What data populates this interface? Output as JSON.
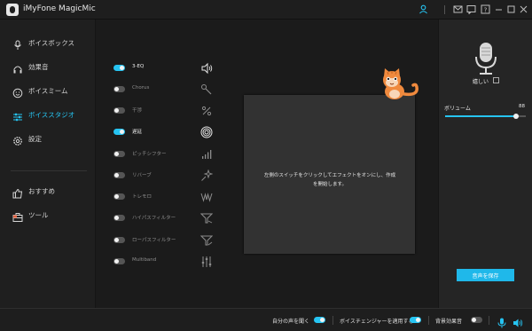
{
  "window": {
    "title": "iMyFone MagicMic",
    "icons": [
      "user-icon",
      "mail-icon",
      "feedback-icon",
      "help-icon",
      "minimize-icon",
      "maximize-icon",
      "close-icon"
    ]
  },
  "sidebar": {
    "items": [
      {
        "label": "ボイスボックス",
        "icon": "microphone-icon"
      },
      {
        "label": "効果音",
        "icon": "headphones-icon"
      },
      {
        "label": "ボイスミーム",
        "icon": "smiley-icon"
      },
      {
        "label": "ボイススタジオ",
        "icon": "sliders-icon",
        "active": true
      },
      {
        "label": "設定",
        "icon": "gear-icon"
      }
    ],
    "bottom_items": [
      {
        "label": "おすすめ",
        "icon": "thumbs-up-icon"
      },
      {
        "label": "ツール",
        "icon": "toolbox-icon"
      }
    ]
  },
  "effects": [
    {
      "label": "3-EQ",
      "on": true,
      "icon": "speaker-icon"
    },
    {
      "label": "Chorus",
      "on": false,
      "icon": "wand-icon"
    },
    {
      "label": "干渉",
      "on": false,
      "icon": "percent-icon"
    },
    {
      "label": "遅延",
      "on": true,
      "icon": "spiral-icon"
    },
    {
      "label": "ピッチシフター",
      "on": false,
      "icon": "bars-icon"
    },
    {
      "label": "リバーブ",
      "on": false,
      "icon": "sparkle-icon"
    },
    {
      "label": "トレモロ",
      "on": false,
      "icon": "wave-icon"
    },
    {
      "label": "ハイパスフィルター",
      "on": false,
      "icon": "highpass-icon"
    },
    {
      "label": "ローパスフィルター",
      "on": false,
      "icon": "lowpass-icon"
    },
    {
      "label": "Multiband",
      "on": false,
      "icon": "equalizer-icon"
    }
  ],
  "center": {
    "message": "左側のスイッチをクリックしてエフェクトをオンにし、作成を開始します。"
  },
  "right_panel": {
    "voice_name": "嬉しい",
    "volume_label": "ボリューム",
    "volume_value": "88",
    "volume_level": 0.88,
    "save_label": "音声を保存"
  },
  "bottom_bar": {
    "hear_self_label": "自分の声を聞く",
    "hear_self_on": true,
    "apply_changer_label": "ボイスチェンジャーを適用する",
    "apply_changer_on": true,
    "bg_effects_label": "背景効果音",
    "bg_effects_on": false
  },
  "colors": {
    "accent": "#26c4f2",
    "background": "#1b1b1b",
    "panel": "#323232"
  }
}
